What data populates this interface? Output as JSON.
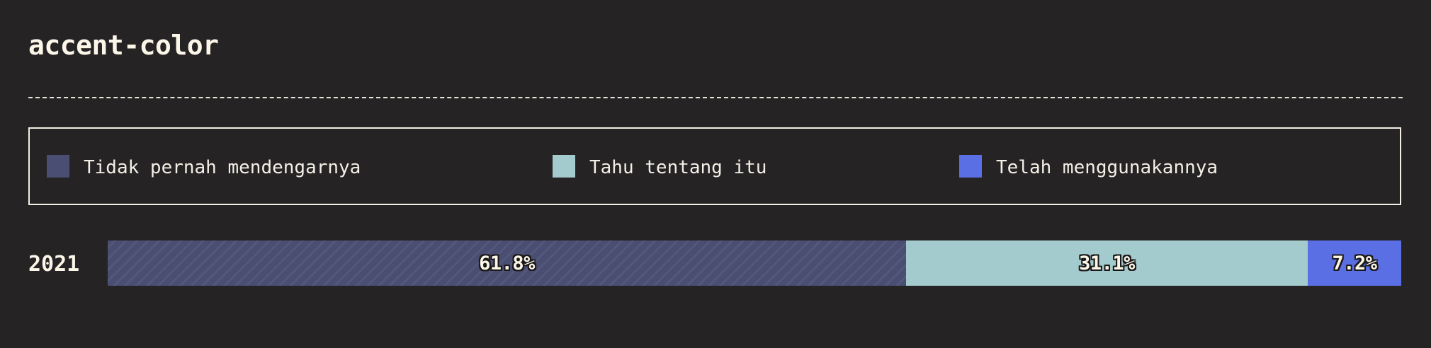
{
  "page": {
    "title": "accent-color"
  },
  "legend": {
    "items": [
      {
        "label": "Tidak pernah mendengarnya",
        "color": "#4a4e72"
      },
      {
        "label": "Tahu tentang itu",
        "color": "#a3cacc"
      },
      {
        "label": "Telah menggunakannya",
        "color": "#5b6fe5"
      }
    ]
  },
  "chart_data": {
    "type": "bar",
    "stacked": true,
    "orientation": "horizontal",
    "title": "accent-color",
    "categories": [
      "2021"
    ],
    "series": [
      {
        "name": "Tidak pernah mendengarnya",
        "values": [
          61.8
        ],
        "label": "61.8%",
        "color": "#4a4e72",
        "hatched": true
      },
      {
        "name": "Tahu tentang itu",
        "values": [
          31.1
        ],
        "label": "31.1%",
        "color": "#a3cacc",
        "hatched": false
      },
      {
        "name": "Telah menggunakannya",
        "values": [
          7.2
        ],
        "label": "7.2%",
        "color": "#5b6fe5",
        "hatched": false
      }
    ],
    "xlim": [
      0,
      100
    ],
    "grid": false,
    "legend_position": "top"
  }
}
